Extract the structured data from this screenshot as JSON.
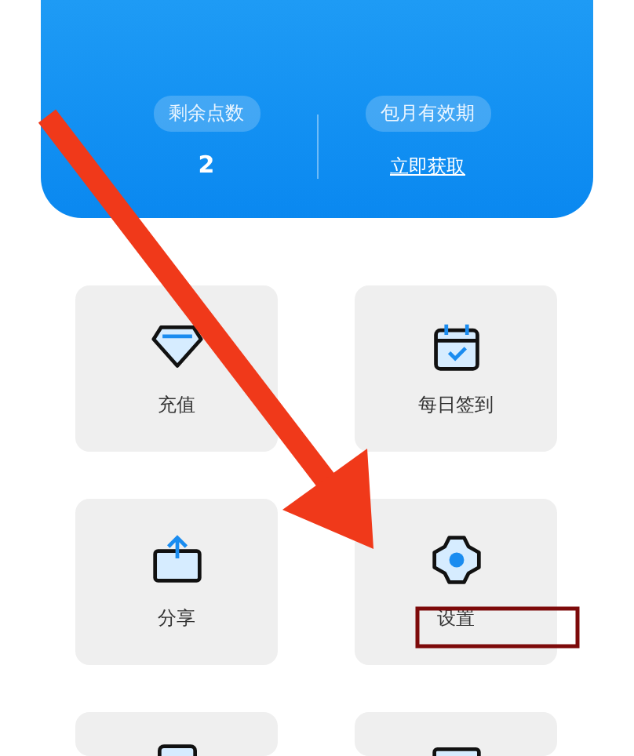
{
  "account_card": {
    "stats": [
      {
        "label": "剩余点数",
        "value": "2",
        "kind": "number"
      },
      {
        "label": "包月有效期",
        "value": "立即获取",
        "kind": "link"
      }
    ]
  },
  "menu": [
    {
      "label": "充值",
      "kind": "full"
    },
    {
      "label": "每日签到",
      "kind": "full"
    },
    {
      "label": "分享",
      "kind": "full"
    },
    {
      "label": "设置",
      "kind": "full"
    },
    {
      "kind": "partial"
    },
    {
      "kind": "partial"
    }
  ],
  "annotations": {
    "arrow": true,
    "highlight_box": true
  }
}
